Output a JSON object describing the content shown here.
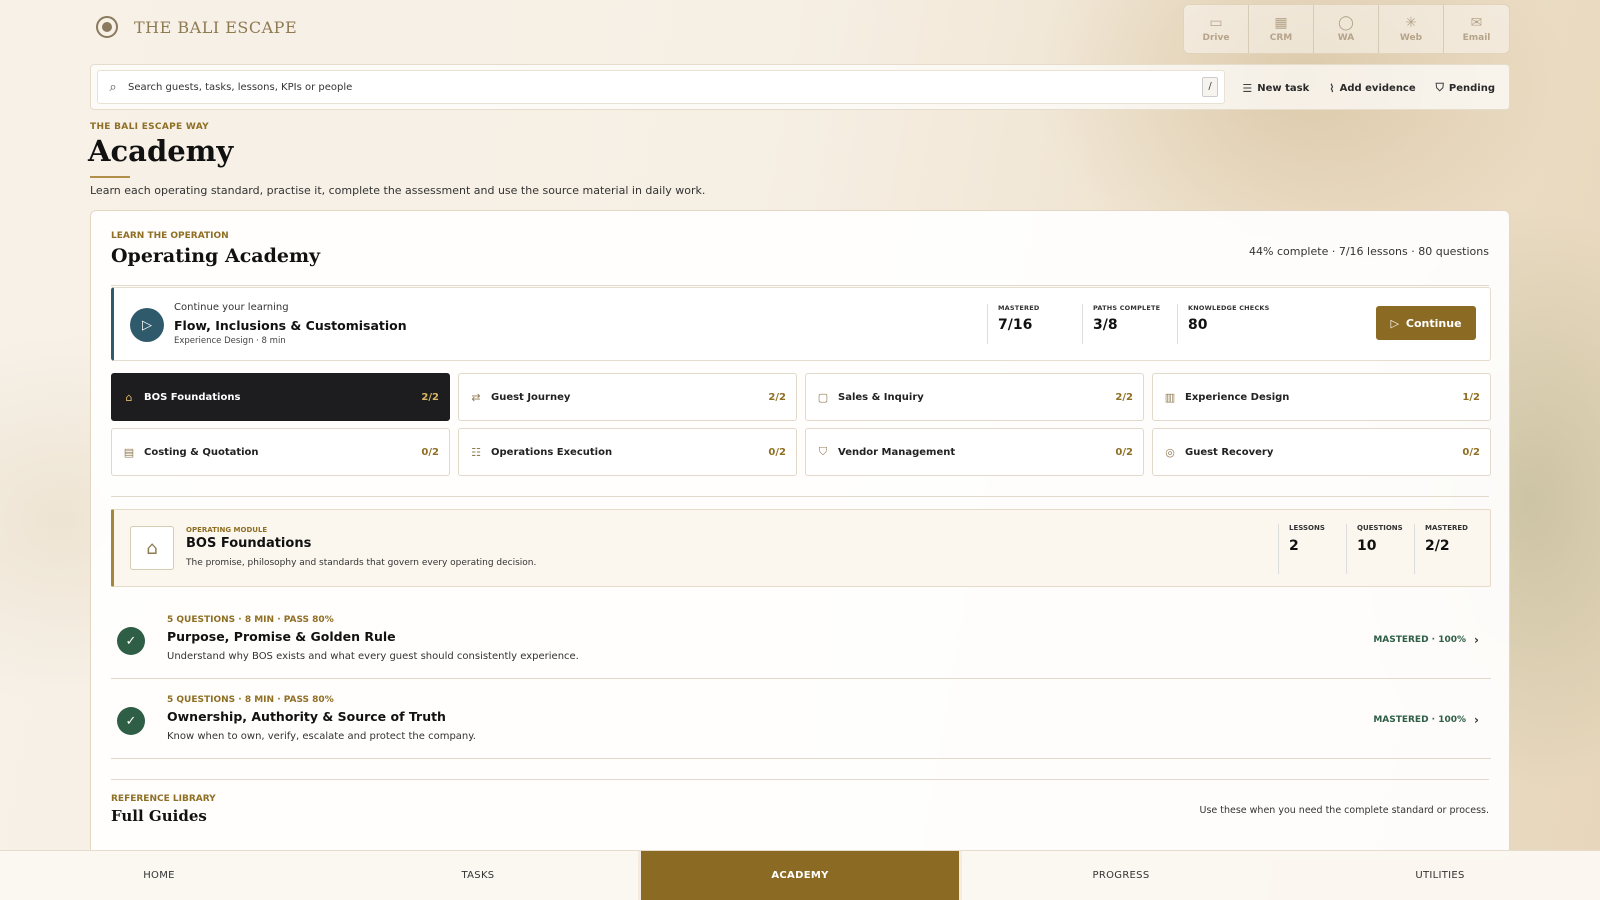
{
  "brand": {
    "name": "THE BALI ESCAPE"
  },
  "apps": [
    {
      "label": "Drive",
      "icon": "folder-icon"
    },
    {
      "label": "CRM",
      "icon": "table-icon"
    },
    {
      "label": "WA",
      "icon": "chat-icon"
    },
    {
      "label": "Web",
      "icon": "globe-icon"
    },
    {
      "label": "Email",
      "icon": "mail-icon"
    }
  ],
  "search": {
    "placeholder": "Search guests, tasks, lessons, KPIs or people",
    "shortcut": "/"
  },
  "quick_actions": [
    {
      "label": "New task",
      "icon": "list-add-icon"
    },
    {
      "label": "Add evidence",
      "icon": "paperclip-icon"
    },
    {
      "label": "Pending",
      "icon": "shield-icon"
    }
  ],
  "page": {
    "eyebrow": "THE BALI ESCAPE WAY",
    "title": "Academy",
    "description": "Learn each operating standard, practise it, complete the assessment and use the source material in daily work."
  },
  "academy": {
    "eyebrow": "LEARN THE OPERATION",
    "title": "Operating Academy",
    "summary": "44% complete · 7/16 lessons · 80 questions"
  },
  "continue_card": {
    "kicker": "Continue your learning",
    "title": "Flow, Inclusions & Customisation",
    "meta": "Experience Design · 8 min",
    "stats": [
      {
        "label": "MASTERED",
        "value": "7/16"
      },
      {
        "label": "PATHS COMPLETE",
        "value": "3/8"
      },
      {
        "label": "KNOWLEDGE CHECKS",
        "value": "80"
      }
    ],
    "button": "Continue"
  },
  "paths": [
    {
      "label": "BOS Foundations",
      "count": "2/2",
      "icon": "bank-icon",
      "active": true
    },
    {
      "label": "Guest Journey",
      "count": "2/2",
      "icon": "route-icon",
      "active": false
    },
    {
      "label": "Sales & Inquiry",
      "count": "2/2",
      "icon": "messages-icon",
      "active": false
    },
    {
      "label": "Experience Design",
      "count": "1/2",
      "icon": "map-icon",
      "active": false
    },
    {
      "label": "Costing & Quotation",
      "count": "0/2",
      "icon": "receipt-icon",
      "active": false
    },
    {
      "label": "Operations Execution",
      "count": "0/2",
      "icon": "checklist-icon",
      "active": false
    },
    {
      "label": "Vendor Management",
      "count": "0/2",
      "icon": "handshake-icon",
      "active": false
    },
    {
      "label": "Guest Recovery",
      "count": "0/2",
      "icon": "lifebuoy-icon",
      "active": false
    }
  ],
  "module": {
    "eyebrow": "OPERATING MODULE",
    "title": "BOS Foundations",
    "description": "The promise, philosophy and standards that govern every operating decision.",
    "stats": [
      {
        "label": "LESSONS",
        "value": "2"
      },
      {
        "label": "QUESTIONS",
        "value": "10"
      },
      {
        "label": "MASTERED",
        "value": "2/2"
      }
    ]
  },
  "lessons": [
    {
      "meta": "5 QUESTIONS · 8 MIN · PASS 80%",
      "title": "Purpose, Promise & Golden Rule",
      "description": "Understand why BOS exists and what every guest should consistently experience.",
      "status": "MASTERED · 100%"
    },
    {
      "meta": "5 QUESTIONS · 8 MIN · PASS 80%",
      "title": "Ownership, Authority & Source of Truth",
      "description": "Know when to own, verify, escalate and protect the company.",
      "status": "MASTERED · 100%"
    }
  ],
  "library": {
    "eyebrow": "REFERENCE LIBRARY",
    "title": "Full Guides",
    "note": "Use these when you need the complete standard or process."
  },
  "nav": [
    {
      "label": "HOME",
      "active": false
    },
    {
      "label": "TASKS",
      "active": false
    },
    {
      "label": "ACADEMY",
      "active": true
    },
    {
      "label": "PROGRESS",
      "active": false
    },
    {
      "label": "UTILITIES",
      "active": false
    }
  ],
  "colors": {
    "accent": "#8b6a24",
    "dark_tile": "#1d1d1f",
    "mastered_green": "#2e5e45",
    "play_blue": "#2f5a6b"
  }
}
